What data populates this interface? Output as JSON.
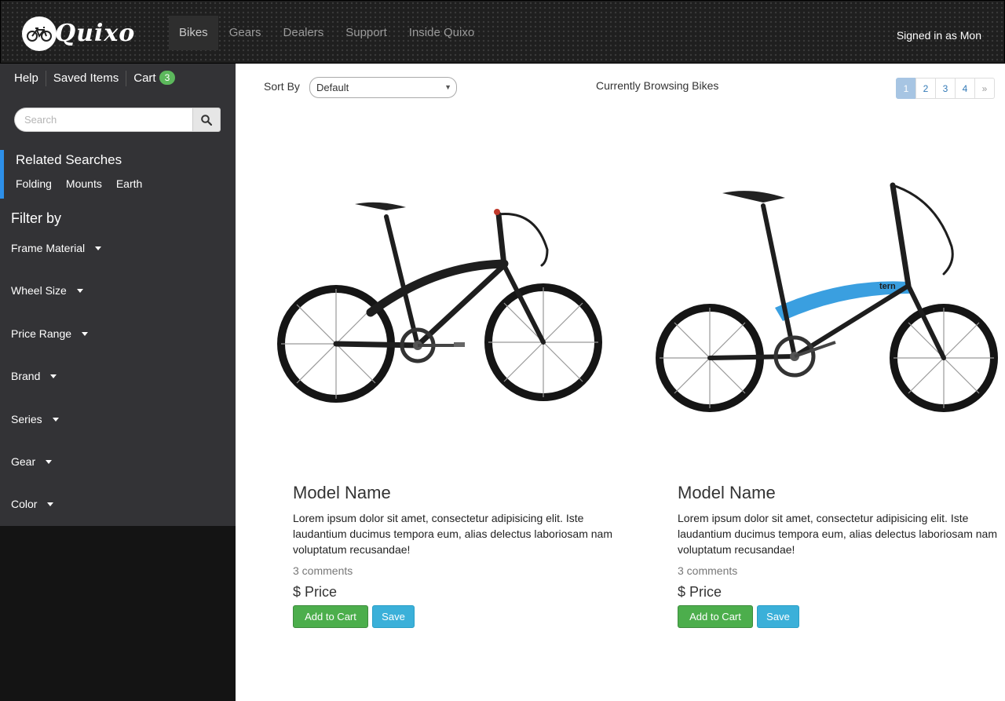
{
  "brand": {
    "name": "Quixo"
  },
  "nav": {
    "items": [
      {
        "label": "Bikes",
        "active": true
      },
      {
        "label": "Gears",
        "active": false
      },
      {
        "label": "Dealers",
        "active": false
      },
      {
        "label": "Support",
        "active": false
      },
      {
        "label": "Inside Quixo",
        "active": false
      }
    ],
    "signed_in": "Signed in as Mon"
  },
  "sidebar": {
    "links": {
      "help": "Help",
      "saved": "Saved Items",
      "cart": "Cart",
      "cart_count": "3"
    },
    "search": {
      "placeholder": "Search"
    },
    "related": {
      "title": "Related Searches",
      "tags": [
        "Folding",
        "Mounts",
        "Earth"
      ]
    },
    "filter": {
      "title": "Filter by",
      "items": [
        "Frame Material",
        "Wheel Size",
        "Price Range",
        "Brand",
        "Series",
        "Gear",
        "Color"
      ]
    }
  },
  "toolbar": {
    "sort_label": "Sort By",
    "sort_value": "Default",
    "browsing": "Currently Browsing Bikes",
    "pages": [
      "1",
      "2",
      "3",
      "4",
      "»"
    ],
    "active_page": "1"
  },
  "products": [
    {
      "title": "Model Name",
      "description": "Lorem ipsum dolor sit amet, consectetur adipisicing elit. Iste laudantium ducimus tempora eum, alias delectus laboriosam nam voluptatum recusandae!",
      "comments": "3 comments",
      "price": "$ Price",
      "add_label": "Add to Cart",
      "save_label": "Save",
      "frame_color": "#1a1a1a"
    },
    {
      "title": "Model Name",
      "description": "Lorem ipsum dolor sit amet, consectetur adipisicing elit. Iste laudantium ducimus tempora eum, alias delectus laboriosam nam voluptatum recusandae!",
      "comments": "3 comments",
      "price": "$ Price",
      "add_label": "Add to Cart",
      "save_label": "Save",
      "frame_color": "#3a9fe0"
    }
  ],
  "colors": {
    "accent": "#2d8fe8",
    "success": "#4cae4c",
    "info": "#3bb0d9",
    "badge": "#5cb85c"
  }
}
